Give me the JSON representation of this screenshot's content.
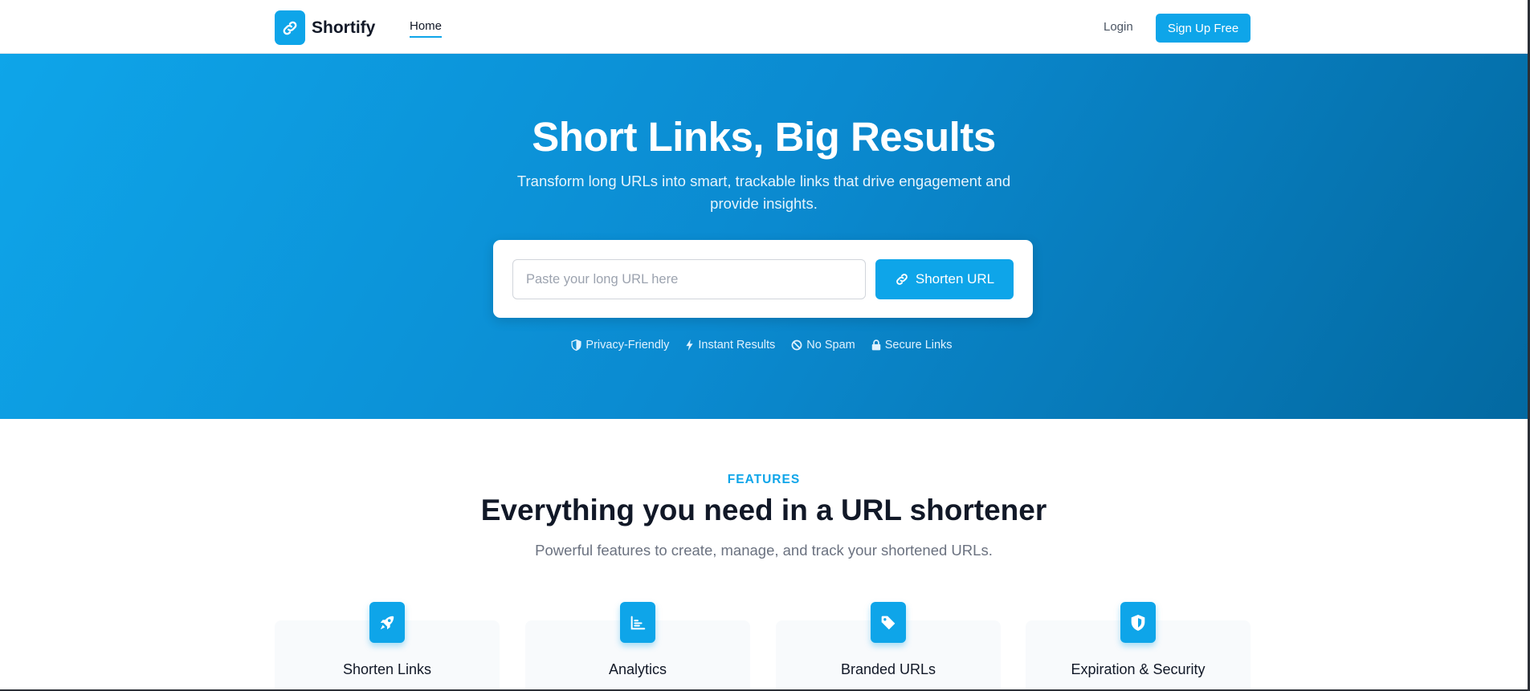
{
  "header": {
    "brand_name": "Shortify",
    "brand_icon": "link-icon",
    "nav_home": "Home",
    "login": "Login",
    "signup": "Sign Up Free"
  },
  "hero": {
    "title": "Short Links, Big Results",
    "subtitle": "Transform long URLs into smart, trackable links that drive engagement and provide insights.",
    "input_placeholder": "Paste your long URL here",
    "input_value": "",
    "button_label": "Shorten URL",
    "badges": [
      {
        "label": "Privacy-Friendly",
        "icon": "shield-half-icon"
      },
      {
        "label": "Instant Results",
        "icon": "bolt-icon"
      },
      {
        "label": "No Spam",
        "icon": "ban-icon"
      },
      {
        "label": "Secure Links",
        "icon": "lock-icon"
      }
    ]
  },
  "features": {
    "eyebrow": "FEATURES",
    "title": "Everything you need in a URL shortener",
    "subtitle": "Powerful features to create, manage, and track your shortened URLs.",
    "cards": [
      {
        "label": "Shorten Links",
        "icon": "rocket-icon"
      },
      {
        "label": "Analytics",
        "icon": "chart-icon"
      },
      {
        "label": "Branded URLs",
        "icon": "tag-icon"
      },
      {
        "label": "Expiration & Security",
        "icon": "shield-icon"
      }
    ]
  },
  "colors": {
    "accent": "#0ea5e9",
    "hero_gradient_end": "#0369a1",
    "text_dark": "#111827",
    "text_muted": "#6b7280"
  }
}
